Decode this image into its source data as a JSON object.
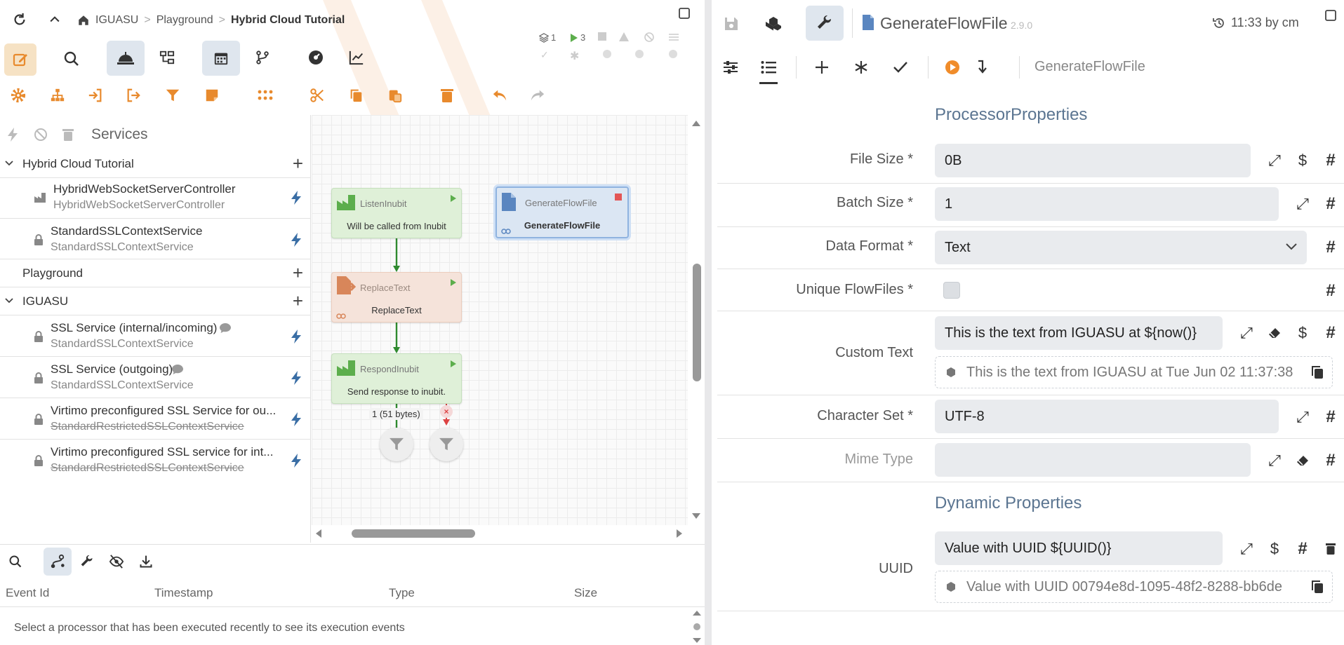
{
  "breadcrumb": {
    "items": [
      "IGUASU",
      "Playground",
      "Hybrid Cloud Tutorial"
    ]
  },
  "status": {
    "versions": "1",
    "running": "3"
  },
  "services": {
    "title": "Services",
    "groups": [
      {
        "name": "Hybrid Cloud Tutorial",
        "items": [
          {
            "name": "HybridWebSocketServerController",
            "type": "HybridWebSocketServerController"
          },
          {
            "name": "StandardSSLContextService",
            "type": "StandardSSLContextService"
          }
        ]
      },
      {
        "name": "Playground",
        "items": []
      },
      {
        "name": "IGUASU",
        "items": [
          {
            "name": "SSL Service (internal/incoming)",
            "type": "StandardSSLContextService"
          },
          {
            "name": "SSL Service (outgoing)",
            "type": "StandardSSLContextService"
          },
          {
            "name": "Virtimo preconfigured SSL Service for ou...",
            "type": "StandardRestrictedSSLContextService"
          },
          {
            "name": "Virtimo preconfigured SSL service for int...",
            "type": "StandardRestrictedSSLContextService"
          }
        ]
      }
    ]
  },
  "canvas": {
    "processors": [
      {
        "type": "ListenInubit",
        "name": "Will be called from Inubit"
      },
      {
        "type": "GenerateFlowFile",
        "name": "GenerateFlowFile"
      },
      {
        "type": "ReplaceText",
        "name": "ReplaceText"
      },
      {
        "type": "RespondInubit",
        "name": "Send response to inubit."
      }
    ],
    "queue_label": "1 (51 bytes)"
  },
  "events": {
    "columns": [
      "Event Id",
      "Timestamp",
      "Type",
      "Size"
    ],
    "empty_message": "Select a processor that has been executed recently to see its execution events"
  },
  "editor": {
    "processor_name": "GenerateFlowFile",
    "version": "2.9.0",
    "last_modified": "11:33 by cm",
    "subtitle": "GenerateFlowFile",
    "section_processor": "ProcessorProperties",
    "section_dynamic": "Dynamic Properties",
    "properties": {
      "file_size": {
        "label": "File Size *",
        "value": "0B"
      },
      "batch_size": {
        "label": "Batch Size *",
        "value": "1"
      },
      "data_format": {
        "label": "Data Format *",
        "value": "Text"
      },
      "unique_flowfiles": {
        "label": "Unique FlowFiles *"
      },
      "custom_text": {
        "label": "Custom Text",
        "value": "This is the text from IGUASU at ${now()}",
        "preview": "This is the text from IGUASU at Tue Jun 02 11:37:38"
      },
      "character_set": {
        "label": "Character Set *",
        "value": "UTF-8"
      },
      "mime_type": {
        "label": "Mime Type",
        "value": ""
      }
    },
    "dynamic": {
      "uuid": {
        "label": "UUID",
        "value": "Value with UUID ${UUID()}",
        "preview": "Value with UUID 00794e8d-1095-48f2-8288-bb6de"
      }
    }
  },
  "colors": {
    "accent_orange": "#e88a2d",
    "green": "#5cae4c",
    "blue": "#5a86c0",
    "lightning": "#3a6ea5"
  }
}
